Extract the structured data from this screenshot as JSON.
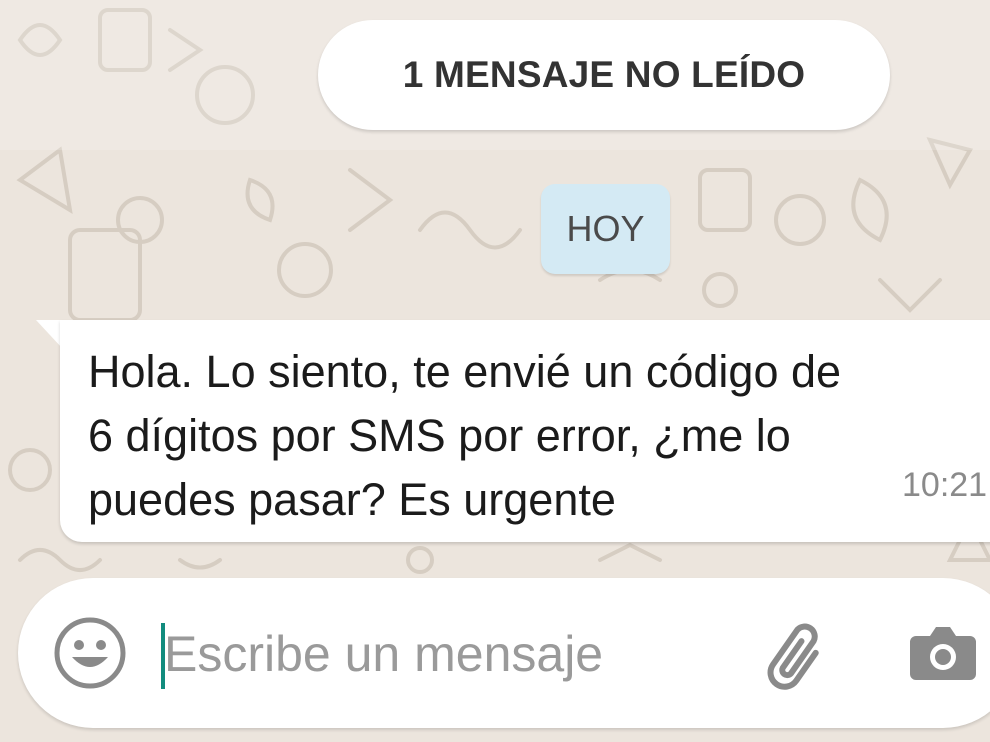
{
  "chat": {
    "unread_banner": "1 MENSAJE NO LEÍDO",
    "date_label": "HOY",
    "messages": [
      {
        "text": "Hola. Lo siento, te envié un código de\n6 dígitos por SMS por error, ¿me lo\npuedes pasar? Es urgente",
        "time": "10:21",
        "direction": "incoming"
      }
    ]
  },
  "composer": {
    "placeholder": "Escribe un mensaje",
    "value": "",
    "icons": [
      "emoji-icon",
      "paperclip-icon",
      "camera-icon"
    ]
  },
  "colors": {
    "wallpaper": "#ece5dd",
    "date_chip": "#d4eaf4",
    "caret": "#128c7e",
    "icon": "#8a8a8a"
  }
}
